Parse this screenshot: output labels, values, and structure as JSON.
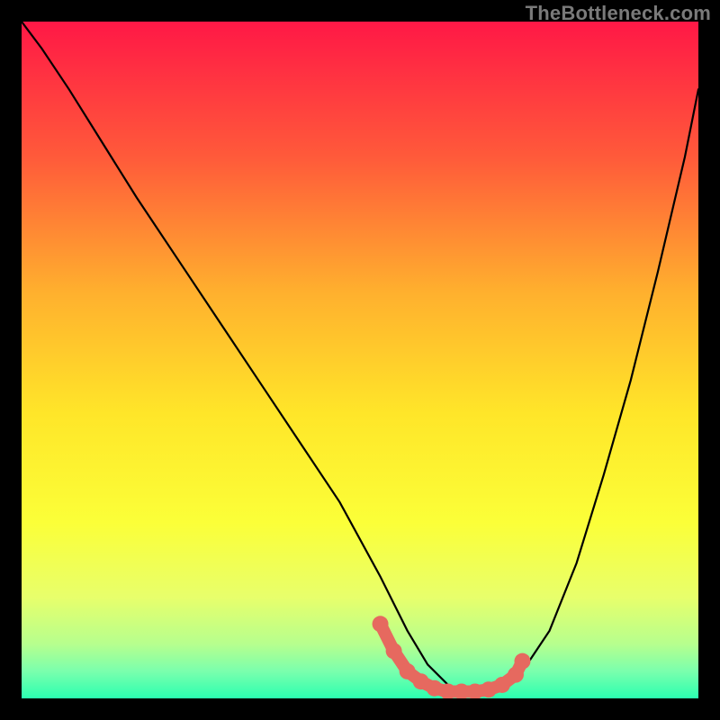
{
  "watermark": "TheBottleneck.com",
  "chart_data": {
    "type": "line",
    "title": "",
    "xlabel": "",
    "ylabel": "",
    "xlim": [
      0,
      100
    ],
    "ylim": [
      0,
      100
    ],
    "grid": false,
    "legend": false,
    "background_gradient_stops": [
      {
        "offset": 0.0,
        "color": "#ff1846"
      },
      {
        "offset": 0.2,
        "color": "#ff5a3a"
      },
      {
        "offset": 0.4,
        "color": "#ffb02e"
      },
      {
        "offset": 0.58,
        "color": "#ffe629"
      },
      {
        "offset": 0.74,
        "color": "#fbff38"
      },
      {
        "offset": 0.85,
        "color": "#e8ff6b"
      },
      {
        "offset": 0.92,
        "color": "#b6ff8e"
      },
      {
        "offset": 0.96,
        "color": "#7affad"
      },
      {
        "offset": 1.0,
        "color": "#2bffb0"
      }
    ],
    "series": [
      {
        "name": "bottleneck-curve",
        "x": [
          0,
          3,
          7,
          12,
          17,
          23,
          29,
          35,
          41,
          47,
          53,
          57,
          60,
          63,
          66,
          69,
          72,
          74,
          78,
          82,
          86,
          90,
          94,
          98,
          100
        ],
        "y": [
          100,
          96,
          90,
          82,
          74,
          65,
          56,
          47,
          38,
          29,
          18,
          10,
          5,
          2,
          1,
          1,
          2,
          4,
          10,
          20,
          33,
          47,
          63,
          80,
          90
        ]
      }
    ],
    "highlight": {
      "name": "minimum-band",
      "color": "#e6695f",
      "x": [
        53,
        55,
        57,
        59,
        61,
        63,
        65,
        67,
        69,
        71,
        73,
        74
      ],
      "y": [
        11,
        7,
        4,
        2.5,
        1.5,
        1,
        1,
        1,
        1.3,
        2,
        3.5,
        5.5
      ]
    }
  }
}
